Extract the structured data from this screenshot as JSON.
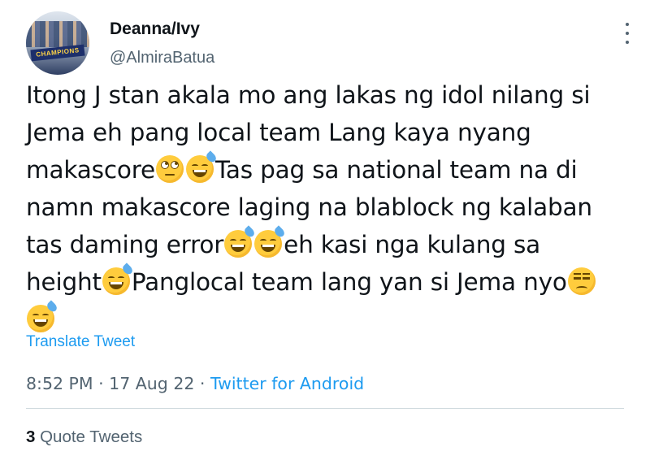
{
  "user": {
    "display_name": "Deanna/Ivy",
    "handle": "@AlmiraBatua",
    "avatar_banner": "CHAMPIONS"
  },
  "tweet": {
    "line1": "Itong J stan akala mo ang lakas ng idol nilang si",
    "line2": "Jema eh pang local team Lang kaya nyang",
    "line3a": "makascore",
    "line3b": "Tas pag sa national team na di",
    "line4": "namn makascore laging na blablock ng kalaban",
    "line5a": "tas daming error",
    "line5b": "eh kasi nga kulang sa",
    "line6a": "height",
    "line6b": "Panglocal team lang yan si Jema nyo"
  },
  "actions": {
    "translate_label": "Translate Tweet"
  },
  "meta": {
    "time": "8:52 PM",
    "separator1": " · ",
    "date": "17 Aug 22",
    "separator2": " · ",
    "source": "Twitter for Android"
  },
  "stats": {
    "quote_count": "3",
    "quote_label": " Quote Tweets"
  },
  "colors": {
    "link": "#1d9bf0",
    "secondary_text": "#536471",
    "primary_text": "#0f1419"
  }
}
